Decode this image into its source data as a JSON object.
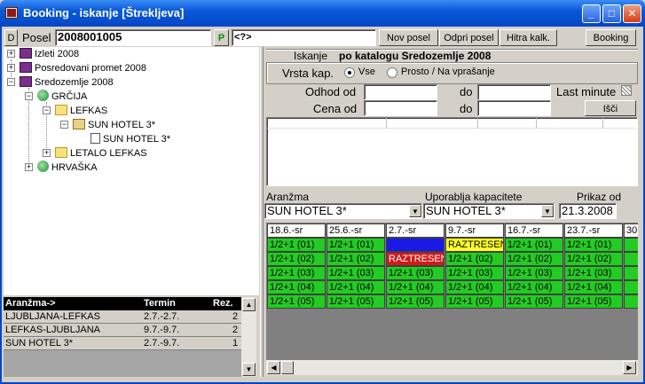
{
  "window": {
    "title": "Booking - iskanje [Štrekljeva]"
  },
  "toolbar": {
    "d_label": "D",
    "posel_label": "Posel",
    "posel_value": "2008001005",
    "p_label": "P",
    "filter_value": "<?>",
    "nov_posel": "Nov posel",
    "odpri_posel": "Odpri posel",
    "hitra_kalk": "Hitra kalk.",
    "booking": "Booking"
  },
  "tree": [
    {
      "label": "Izleti 2008",
      "icon": "book-icon",
      "expander": "+"
    },
    {
      "label": "Posredovani promet 2008",
      "icon": "book-icon",
      "expander": "+"
    },
    {
      "label": "Sredozemlje 2008",
      "icon": "book-icon",
      "expander": "−"
    },
    {
      "label": "GRČIJA",
      "icon": "globe-icon",
      "expander": "−"
    },
    {
      "label": "LEFKAS",
      "icon": "folder-icon",
      "expander": "−"
    },
    {
      "label": "SUN HOTEL 3*",
      "icon": "house-icon",
      "expander": "−"
    },
    {
      "label": "SUN HOTEL 3*",
      "icon": "document-icon",
      "expander": ""
    },
    {
      "label": "LETALO LEFKAS",
      "icon": "folder-icon",
      "expander": "+"
    },
    {
      "label": "HRVAŠKA",
      "icon": "globe-icon",
      "expander": "+"
    }
  ],
  "arrangements_table": {
    "headers": [
      "Aranžma->",
      "Termin",
      "Rez."
    ],
    "rows": [
      [
        "LJUBLJANA-LEFKAS",
        "2.7.-2.7.",
        "2"
      ],
      [
        "LEFKAS-LJUBLJANA",
        "9.7.-9.7.",
        "2"
      ],
      [
        "SUN HOTEL 3*",
        "2.7.-9.7.",
        "1"
      ]
    ]
  },
  "search": {
    "iskanje_label": "Iskanje",
    "iskanje_value": "po katalogu Sredozemlje 2008",
    "vrsta_kap_label": "Vrsta kap.",
    "radio_vse": "Vse",
    "radio_prosto": "Prosto / Na vprašanje",
    "odhod_label": "Odhod od",
    "cena_label": "Cena od",
    "do_label": "do",
    "last_minute_label": "Last minute",
    "isci_button": "Išči"
  },
  "selectors": {
    "aranzma_label": "Aranžma",
    "aranzma_value": "SUN HOTEL 3*",
    "uporablja_label": "Uporablja kapacitete",
    "uporablja_value": "SUN HOTEL 3*",
    "prikaz_label": "Prikaz od",
    "prikaz_value": "21.3.2008"
  },
  "schedule": {
    "columns": [
      "18.6.-sr",
      "25.6.-sr",
      "2.7.-sr",
      "9.7.-sr",
      "16.7.-sr",
      "23.7.-sr",
      "30"
    ],
    "rows": [
      [
        [
          "1/2+1 (01)",
          "#22cc22"
        ],
        [
          "1/2+1 (01)",
          "#22cc22"
        ],
        [
          "",
          "#1a1ae6"
        ],
        [
          "RAZTRESEN",
          "#ffff22"
        ],
        [
          "1/2+1 (01)",
          "#22cc22"
        ],
        [
          "1/2+1 (01)",
          "#22cc22"
        ],
        [
          "",
          "#22cc22"
        ]
      ],
      [
        [
          "1/2+1 (02)",
          "#22cc22"
        ],
        [
          "1/2+1 (02)",
          "#22cc22"
        ],
        [
          "RAZTRESEN",
          "#d21a1a"
        ],
        [
          "1/2+1 (02)",
          "#22cc22"
        ],
        [
          "1/2+1 (02)",
          "#22cc22"
        ],
        [
          "1/2+1 (02)",
          "#22cc22"
        ],
        [
          "",
          "#22cc22"
        ]
      ],
      [
        [
          "1/2+1 (03)",
          "#22cc22"
        ],
        [
          "1/2+1 (03)",
          "#22cc22"
        ],
        [
          "1/2+1 (03)",
          "#22cc22"
        ],
        [
          "1/2+1 (03)",
          "#22cc22"
        ],
        [
          "1/2+1 (03)",
          "#22cc22"
        ],
        [
          "1/2+1 (03)",
          "#22cc22"
        ],
        [
          "",
          "#22cc22"
        ]
      ],
      [
        [
          "1/2+1 (04)",
          "#22cc22"
        ],
        [
          "1/2+1 (04)",
          "#22cc22"
        ],
        [
          "1/2+1 (04)",
          "#22cc22"
        ],
        [
          "1/2+1 (04)",
          "#22cc22"
        ],
        [
          "1/2+1 (04)",
          "#22cc22"
        ],
        [
          "1/2+1 (04)",
          "#22cc22"
        ],
        [
          "",
          "#22cc22"
        ]
      ],
      [
        [
          "1/2+1 (05)",
          "#22cc22"
        ],
        [
          "1/2+1 (05)",
          "#22cc22"
        ],
        [
          "1/2+1 (05)",
          "#22cc22"
        ],
        [
          "1/2+1 (05)",
          "#22cc22"
        ],
        [
          "1/2+1 (05)",
          "#22cc22"
        ],
        [
          "1/2+1 (05)",
          "#22cc22"
        ],
        [
          "",
          "#22cc22"
        ]
      ]
    ]
  }
}
